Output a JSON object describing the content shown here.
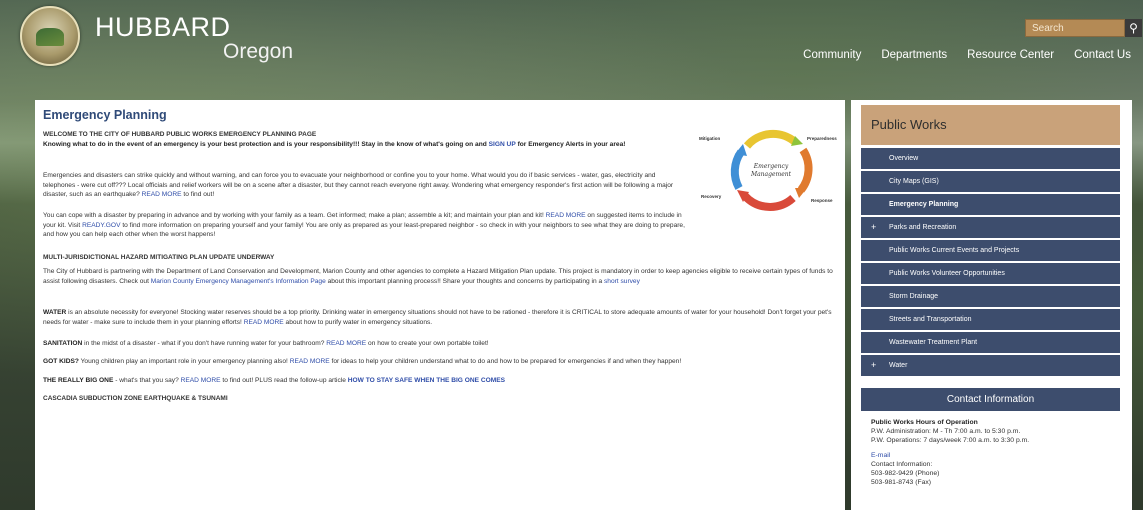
{
  "header": {
    "city": "HUBBARD",
    "state": "Oregon",
    "search_placeholder": "Search",
    "search_icon": "magnifier-icon",
    "nav": [
      "Community",
      "Departments",
      "Resource Center",
      "Contact Us"
    ]
  },
  "page": {
    "title": "Emergency Planning",
    "welcome": "WELCOME TO THE CITY OF HUBBARD PUBLIC WORKS EMERGENCY PLANNING PAGE",
    "intro_bold": "Knowing what to do in the event of an emergency is your best protection and is your responsibility!!! Stay in the know of what's going on and",
    "intro_link": "SIGN UP",
    "intro_end": "for Emergency Alerts in your area!",
    "p1": "Emergencies and disasters can strike quickly and without warning, and can force you to evacuate your neighborhood or confine you to your home. What would you do if basic services - water, gas, electricity and telephones - were cut off??? Local officials and relief workers will be on a scene after a disaster, but they cannot reach everyone right away. Wondering what emergency responder's first action will be following a major disaster, such as an earthquake?",
    "p1_link": "READ MORE",
    "p1_end": "to find out!",
    "p2_a": "You can cope with a disaster by preparing in advance and by working with your family as a team. Get informed; make a plan; assemble a kit; and maintain your plan and kit!",
    "p2_link1": "READ MORE",
    "p2_b": "on suggested items to include in your kit. Visit",
    "p2_link2": "READY.GOV",
    "p2_c": "to find more information on preparing yourself and your family! You are only as prepared as your least-prepared neighbor - so check in with your neighbors to see what they are doing to prepare, and how you can help each other when the worst happens!",
    "hazard_heading": "MULTI-JURISDICTIONAL HAZARD MITIGATING PLAN UPDATE UNDERWAY",
    "hazard_a": "The City of Hubbard is partnering with the Department of Land Conservation and Development, Marion County and other agencies to complete a Hazard Mitigation Plan update. This project is mandatory in order to keep agencies eligible to receive certain types of funds to assist following disasters. Check out",
    "hazard_link1": "Marion County Emergency Management's Information Page",
    "hazard_b": "about this important planning process!! Share your thoughts and concerns by participating in a",
    "hazard_link2": "short survey",
    "water_bold": "WATER",
    "water_a": "is an absolute necessity for everyone! Stocking water reserves should be a top priority. Drinking water in emergency situations should not have to be rationed - therefore it is CRITICAL to store adequate amounts of water for your household! Don't forget your pet's needs for water - make sure to include them in your planning efforts!",
    "water_link": "READ MORE",
    "water_b": "about how to purify water in emergency situations.",
    "sanitation_bold": "SANITATION",
    "sanitation_a": "in the midst of a disaster - what if you don't have running water for your bathroom?",
    "sanitation_link": "READ MORE",
    "sanitation_b": "on how to create your own portable toilet!",
    "kids_bold": "GOT KIDS?",
    "kids_a": "Young children play an important role in your emergency planning also!",
    "kids_link": "READ MORE",
    "kids_b": "for ideas to help your children understand what to do and how to be prepared for emergencies if and when they happen!",
    "bigone_bold": "THE REALLY BIG ONE",
    "bigone_a": "- what's that you say?",
    "bigone_link": "READ MORE",
    "bigone_b": "to find out! PLUS read the follow-up article",
    "bigone_link2": "HOW TO STAY SAFE WHEN THE BIG ONE COMES",
    "cascadia": "CASCADIA SUBDUCTION ZONE EARTHQUAKE & TSUNAMI",
    "cycle": {
      "center": "Emergency Management",
      "labels": [
        "Mitigation",
        "Preparedness",
        "Response",
        "Recovery"
      ]
    }
  },
  "sidebar": {
    "title": "Public Works",
    "menu": [
      {
        "label": "Overview",
        "plus": false,
        "active": false
      },
      {
        "label": "City Maps (GIS)",
        "plus": false,
        "active": false
      },
      {
        "label": "Emergency Planning",
        "plus": false,
        "active": true
      },
      {
        "label": "Parks and Recreation",
        "plus": true,
        "active": false
      },
      {
        "label": "Public Works Current Events and Projects",
        "plus": false,
        "active": false
      },
      {
        "label": "Public Works Volunteer Opportunities",
        "plus": false,
        "active": false
      },
      {
        "label": "Storm Drainage",
        "plus": false,
        "active": false
      },
      {
        "label": "Streets and Transportation",
        "plus": false,
        "active": false
      },
      {
        "label": "Wastewater Treatment Plant",
        "plus": false,
        "active": false
      },
      {
        "label": "Water",
        "plus": true,
        "active": false
      }
    ],
    "contact": {
      "title": "Contact Information",
      "hours_heading": "Public Works Hours of Operation",
      "line1": "P.W. Administration: M - Th 7:00 a.m. to 5:30 p.m.",
      "line2": "P.W. Operations:  7 days/week 7:00 a.m. to 3:30 p.m.",
      "email": "E-mail",
      "info": "Contact Information:",
      "phone": "503-982-9429 (Phone)",
      "fax": "503-981-8743 (Fax)"
    }
  },
  "colors": {
    "nav_bar": "#3d4d6d",
    "sidebar_title": "#c9a27a",
    "link": "#2f4da8",
    "heading": "#2f4a78"
  }
}
